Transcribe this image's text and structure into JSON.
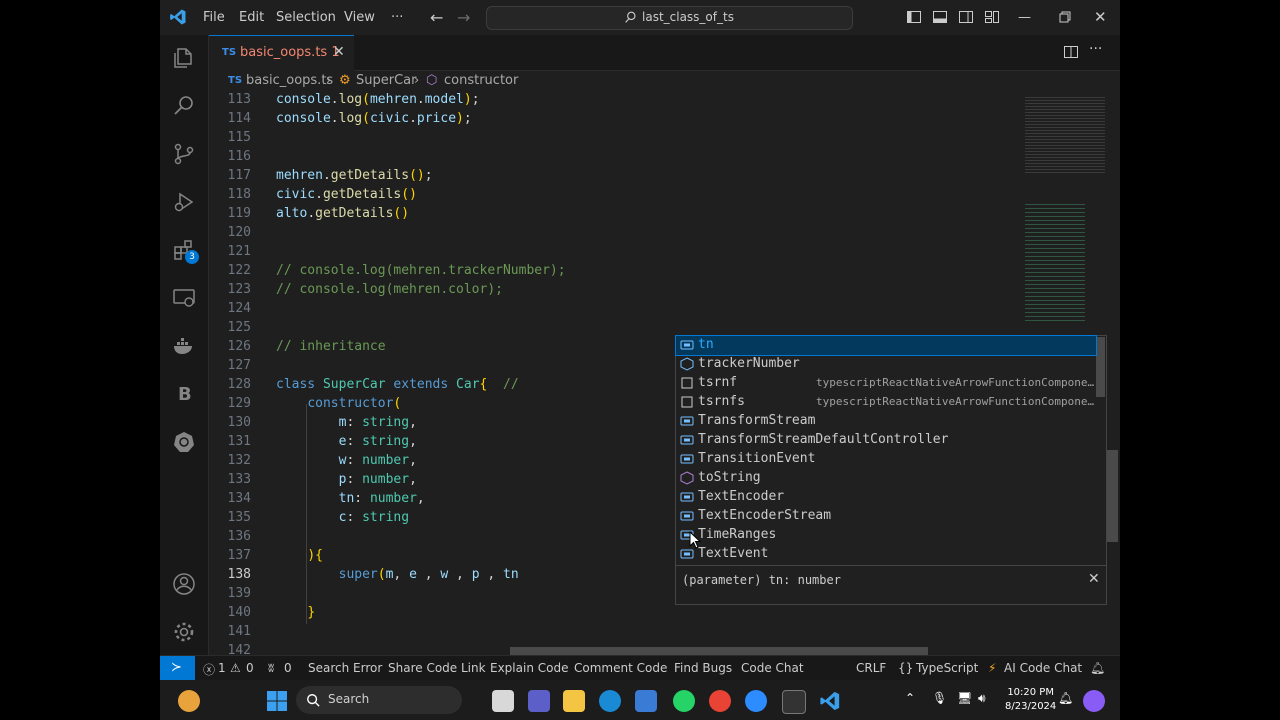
{
  "window": {
    "menus": [
      "File",
      "Edit",
      "Selection",
      "View",
      "···"
    ],
    "search_text": "last_class_of_ts"
  },
  "tab": {
    "lang": "TS",
    "label": "basic_oops.ts 1",
    "close": "✕"
  },
  "breadcrumb": {
    "lang": "TS",
    "file": "basic_oops.ts",
    "class": "SuperCar",
    "method": "constructor",
    "sep": "›"
  },
  "activity_badge": "3",
  "editor": {
    "lines": [
      {
        "n": "113",
        "code": "console.log(mehren.model);"
      },
      {
        "n": "114",
        "code": "console.log(civic.price);"
      },
      {
        "n": "115",
        "code": ""
      },
      {
        "n": "116",
        "code": ""
      },
      {
        "n": "117",
        "code": "mehren.getDetails();"
      },
      {
        "n": "118",
        "code": "civic.getDetails()"
      },
      {
        "n": "119",
        "code": "alto.getDetails()"
      },
      {
        "n": "120",
        "code": ""
      },
      {
        "n": "121",
        "code": ""
      },
      {
        "n": "122",
        "code": "// console.log(mehren.trackerNumber);"
      },
      {
        "n": "123",
        "code": "// console.log(mehren.color);"
      },
      {
        "n": "124",
        "code": ""
      },
      {
        "n": "125",
        "code": ""
      },
      {
        "n": "126",
        "code": "// inheritance"
      },
      {
        "n": "127",
        "code": ""
      },
      {
        "n": "128",
        "code": "class SuperCar extends Car{  //"
      },
      {
        "n": "129",
        "code": "    constructor("
      },
      {
        "n": "130",
        "code": "        m: string,"
      },
      {
        "n": "131",
        "code": "        e: string,"
      },
      {
        "n": "132",
        "code": "        w: number,"
      },
      {
        "n": "133",
        "code": "        p: number,"
      },
      {
        "n": "134",
        "code": "        tn: number,"
      },
      {
        "n": "135",
        "code": "        c: string"
      },
      {
        "n": "136",
        "code": ""
      },
      {
        "n": "137",
        "code": "    ){"
      },
      {
        "n": "138",
        "code": "        super(m, e , w , p , tn"
      },
      {
        "n": "139",
        "code": ""
      },
      {
        "n": "140",
        "code": "    }"
      },
      {
        "n": "141",
        "code": ""
      },
      {
        "n": "142",
        "code": ""
      }
    ]
  },
  "suggest": {
    "items": [
      {
        "label": "tn",
        "detail": "",
        "icon": "variable"
      },
      {
        "label": "trackerNumber",
        "detail": "",
        "icon": "property"
      },
      {
        "label": "tsrnf",
        "detail": "typescriptReactNativeArrowFunctionCompone…",
        "icon": "snippet"
      },
      {
        "label": "tsrnfs",
        "detail": "typescriptReactNativeArrowFunctionCompone…",
        "icon": "snippet"
      },
      {
        "label": "TransformStream",
        "detail": "",
        "icon": "variable"
      },
      {
        "label": "TransformStreamDefaultController",
        "detail": "",
        "icon": "variable"
      },
      {
        "label": "TransitionEvent",
        "detail": "",
        "icon": "variable"
      },
      {
        "label": "toString",
        "detail": "",
        "icon": "method"
      },
      {
        "label": "TextEncoder",
        "detail": "",
        "icon": "variable"
      },
      {
        "label": "TextEncoderStream",
        "detail": "",
        "icon": "variable"
      },
      {
        "label": "TimeRanges",
        "detail": "",
        "icon": "variable"
      },
      {
        "label": "TextEvent",
        "detail": "",
        "icon": "variable"
      }
    ],
    "param_hint": "(parameter) tn: number"
  },
  "status": {
    "errors": "1",
    "warnings": "0",
    "ports": "0",
    "items": [
      "Search Error",
      "Share Code Link",
      "Explain Code",
      "Comment Code",
      "Find Bugs",
      "Code Chat"
    ],
    "eol": "CRLF",
    "language": "TypeScript",
    "ai": "AI Code Chat"
  },
  "taskbar": {
    "search": "Search",
    "time": "10:20 PM",
    "date": "8/23/2024"
  }
}
